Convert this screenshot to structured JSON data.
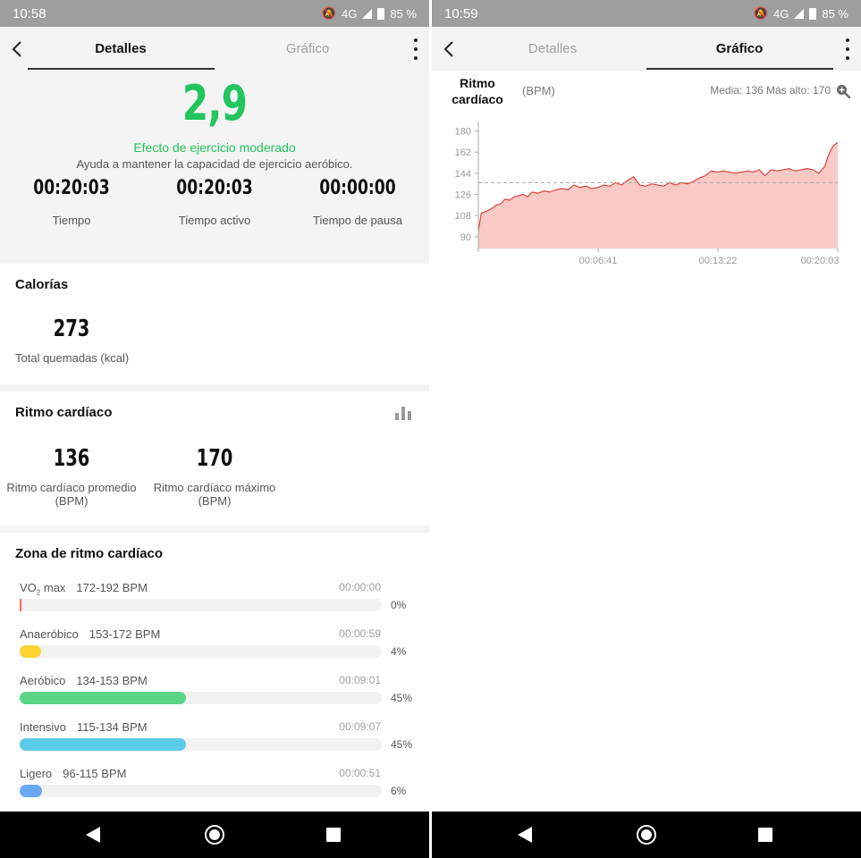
{
  "left": {
    "status": {
      "time": "10:58",
      "network": "4G",
      "battery": "85 %"
    },
    "tabs": {
      "details": "Detalles",
      "chart": "Gráfico",
      "active": "details"
    },
    "score": "2,9",
    "effect": "Efecto de ejercicio moderado",
    "effect_desc": "Ayuda a mantener la capacidad de ejercicio aeróbico.",
    "times": [
      {
        "value": "00:20:03",
        "label": "Tiempo"
      },
      {
        "value": "00:20:03",
        "label": "Tiempo activo"
      },
      {
        "value": "00:00:00",
        "label": "Tiempo de pausa"
      }
    ],
    "calories": {
      "title": "Calorías",
      "value": "273",
      "label": "Total quemadas (kcal)"
    },
    "heart": {
      "title": "Ritmo cardíaco",
      "icon": "bar-chart-icon",
      "avg": {
        "value": "136",
        "label1": "Ritmo cardíaco promedio",
        "label2": "(BPM)"
      },
      "max": {
        "value": "170",
        "label1": "Ritmo cardíaco máximo",
        "label2": "(BPM)"
      }
    },
    "zones": {
      "title": "Zona de ritmo cardíaco",
      "items": [
        {
          "name": "VO",
          "sub": "2",
          "name_suffix": " max",
          "range": "172-192 BPM",
          "time": "00:00:00",
          "pct": "0%",
          "fill": 0.0,
          "color": "#f06a5a"
        },
        {
          "name": "Anaeróbico",
          "sub": "",
          "name_suffix": "",
          "range": "153-172 BPM",
          "time": "00:00:59",
          "pct": "4%",
          "fill": 0.04,
          "color": "#fcd535"
        },
        {
          "name": "Aeróbico",
          "sub": "",
          "name_suffix": "",
          "range": "134-153 BPM",
          "time": "00:09:01",
          "pct": "45%",
          "fill": 0.45,
          "color": "#5ad586"
        },
        {
          "name": "Intensivo",
          "sub": "",
          "name_suffix": "",
          "range": "115-134 BPM",
          "time": "00:09:07",
          "pct": "45%",
          "fill": 0.45,
          "color": "#5ccbe8"
        },
        {
          "name": "Ligero",
          "sub": "",
          "name_suffix": "",
          "range": "96-115 BPM",
          "time": "00:00:51",
          "pct": "6%",
          "fill": 0.06,
          "color": "#6aa8f8"
        }
      ]
    }
  },
  "right": {
    "status": {
      "time": "10:59",
      "network": "4G",
      "battery": "85 %"
    },
    "tabs": {
      "details": "Detalles",
      "chart": "Gráfico",
      "active": "chart"
    },
    "chart_title_line1": "Ritmo",
    "chart_title_line2": "cardíaco",
    "unit": "(BPM)",
    "stats": "Media: 136 Más alto: 170",
    "zoom_icon": "zoom-in-icon"
  },
  "chart_data": {
    "type": "area",
    "title": "Ritmo cardíaco",
    "ylabel": "(BPM)",
    "ylim": [
      80,
      185
    ],
    "yticks": [
      90,
      108,
      126,
      144,
      162,
      180
    ],
    "xlim_seconds": [
      0,
      1203
    ],
    "x_tick_labels": [
      "00:06:41",
      "00:13:22",
      "00:20:03"
    ],
    "x_tick_seconds": [
      401,
      802,
      1203
    ],
    "average": 136,
    "max": 170,
    "line_color": "#d9443a",
    "fill_color": "#f7c0bb",
    "grid": false,
    "x": [
      0,
      10,
      20,
      30,
      45,
      60,
      75,
      90,
      105,
      120,
      135,
      150,
      165,
      180,
      200,
      220,
      240,
      260,
      280,
      300,
      320,
      340,
      360,
      380,
      400,
      420,
      440,
      460,
      480,
      500,
      520,
      540,
      560,
      580,
      600,
      620,
      640,
      660,
      680,
      700,
      720,
      740,
      760,
      780,
      800,
      820,
      840,
      860,
      880,
      900,
      920,
      940,
      960,
      980,
      1000,
      1020,
      1040,
      1060,
      1080,
      1100,
      1120,
      1140,
      1160,
      1170,
      1180,
      1190,
      1203
    ],
    "y": [
      95,
      110,
      111,
      112,
      114,
      117,
      118,
      122,
      121,
      124,
      125,
      126,
      124,
      128,
      127,
      129,
      128,
      130,
      131,
      130,
      134,
      132,
      133,
      131,
      132,
      134,
      133,
      136,
      134,
      138,
      141,
      134,
      133,
      135,
      134,
      133,
      136,
      134,
      136,
      135,
      137,
      140,
      142,
      146,
      145,
      146,
      145,
      144,
      145,
      146,
      145,
      147,
      142,
      147,
      146,
      147,
      148,
      146,
      147,
      148,
      147,
      144,
      150,
      158,
      164,
      168,
      170
    ]
  }
}
